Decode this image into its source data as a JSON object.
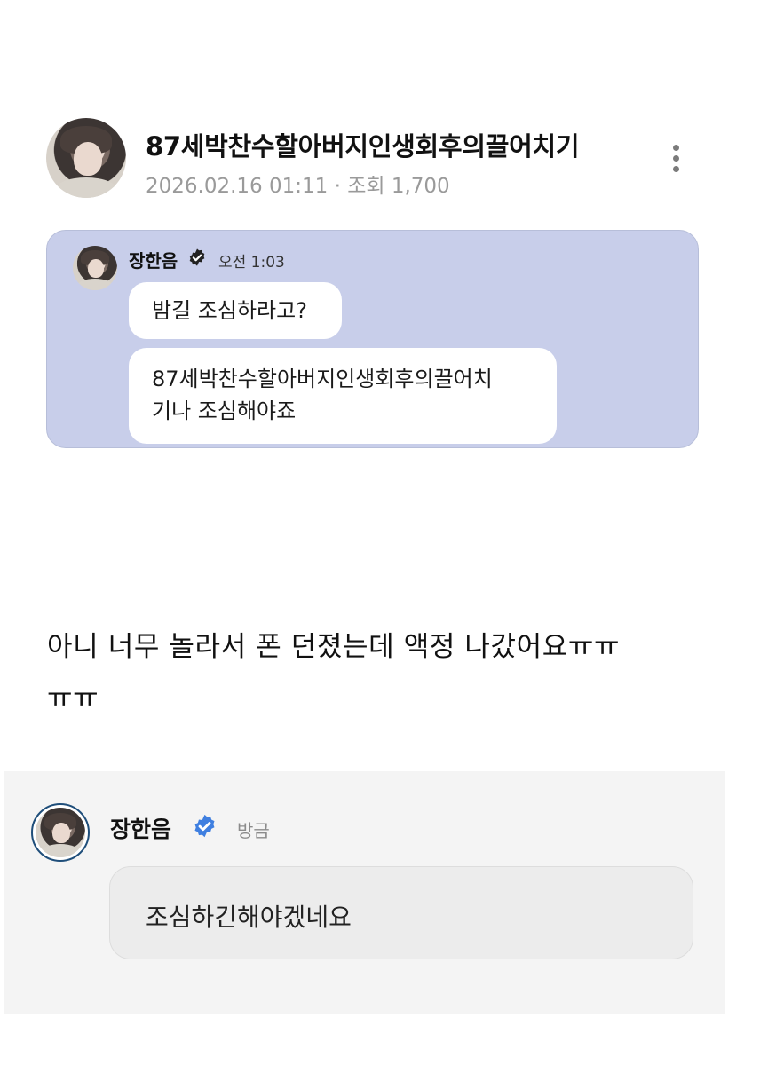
{
  "post": {
    "title": "87세박찬수할아버지인생회후의끌어치기",
    "meta": "2026.02.16 01:11 · 조회 1,700",
    "author_avatar_icon": "profile-photo",
    "more_icon": "more-vertical-icon"
  },
  "chat_screenshot": {
    "background_color": "#c8ceea",
    "sender_name": "장한음",
    "time": "오전 1:03",
    "verified_icon": "verified-check-icon",
    "messages": [
      "밤길 조심하라고?",
      "87세박찬수할아버지인생회후의끌어치\n기나 조심해야죠"
    ]
  },
  "body": {
    "text": "아니 너무 놀라서 폰 던졌는데 액정 나갔어요ㅠㅠ\nㅠㅠ"
  },
  "comment": {
    "author_name": "장한음",
    "verified_icon": "verified-badge-icon",
    "verified_color": "#3f7fe0",
    "time": "방금",
    "text": "조심하긴해야겠네요"
  }
}
